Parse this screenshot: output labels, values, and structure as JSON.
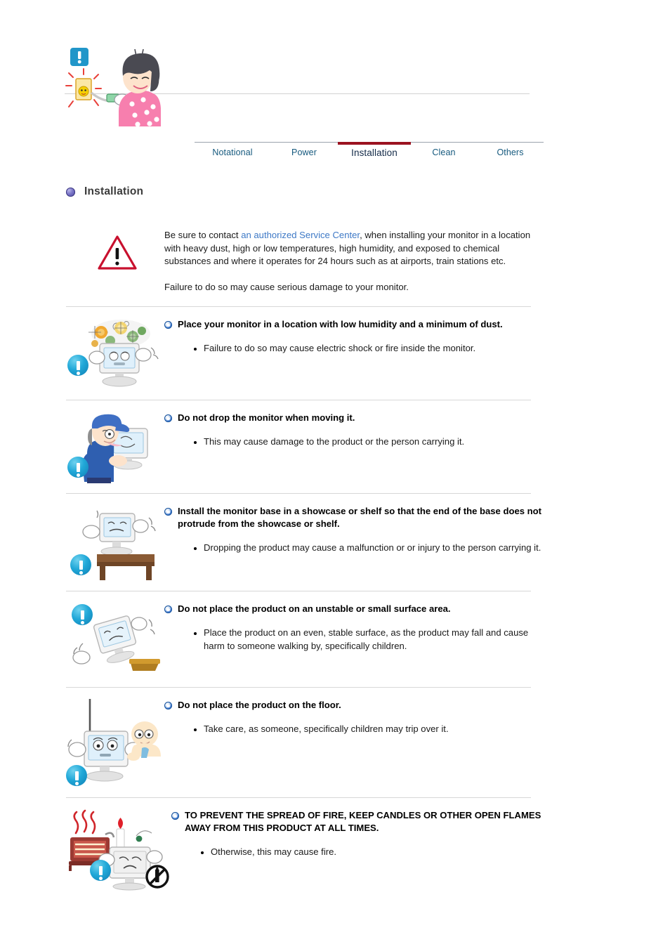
{
  "document": {
    "title": "Installation",
    "heading": "Installation"
  },
  "tabs": [
    {
      "label": "Notational",
      "active": false
    },
    {
      "label": "Power",
      "active": false
    },
    {
      "label": "Installation",
      "active": true
    },
    {
      "label": "Clean",
      "active": false
    },
    {
      "label": "Others",
      "active": false
    }
  ],
  "colors": {
    "tab_text": "#15597e",
    "tab_active_text": "#142b49",
    "tab_active_underline": "#9b1220",
    "link": "#3e79c6",
    "heading_bullet": "#4a45a0",
    "rule_bullet": "#1c4f9c",
    "badge": "#21a8d8",
    "warning_triangle": "#c8102e",
    "divider": "#d7d7d7"
  },
  "warning": {
    "icon": "warning-triangle-icon",
    "paragraph_1_before_link": "Be sure to contact ",
    "paragraph_1_link": "an authorized Service Center",
    "paragraph_1_after_link": ", when installing your monitor in a location with heavy dust, high or low temperatures, high humidity, and exposed to chemical substances and where it operates for 24 hours such as at airports, train stations etc.",
    "paragraph_2": "Failure to do so may cause serious damage to your monitor."
  },
  "top_illustration": {
    "icon": "woman-unplugging-cord-illustration",
    "badge": "blue-exclamation-badge"
  },
  "rules": [
    {
      "icon": "monitor-dust-germs-illustration",
      "heading": "Place your monitor in a location with low humidity and a minimum of dust.",
      "items": [
        "Failure to do so may cause electric shock or fire inside the monitor."
      ]
    },
    {
      "icon": "man-carrying-monitor-illustration",
      "heading": "Do not drop the monitor when moving it.",
      "items": [
        "This may cause damage to the product or the person carrying it."
      ]
    },
    {
      "icon": "monitor-on-shelf-edge-illustration",
      "heading": "Install the monitor base in a showcase or shelf so that the end of the base does not protrude from the showcase or shelf.",
      "items": [
        "Dropping the product may cause a malfunction or or injury to the person carrying it."
      ]
    },
    {
      "icon": "monitor-falling-unstable-surface-illustration",
      "heading": "Do not place the product on an unstable or small surface area.",
      "items": [
        "Place the product on an even, stable surface, as the product may fall and cause harm to someone walking by, specifically children."
      ]
    },
    {
      "icon": "monitor-on-floor-with-child-illustration",
      "heading": "Do not place the product on the floor.",
      "items": [
        "Take care, as someone, specifically children may trip over it."
      ]
    },
    {
      "icon": "heater-candle-fire-hazard-illustration",
      "heading": "TO PREVENT THE SPREAD OF FIRE, KEEP CANDLES OR OTHER OPEN FLAMES AWAY FROM THIS PRODUCT AT ALL TIMES.",
      "items": [
        "Otherwise, this may cause fire."
      ]
    }
  ]
}
